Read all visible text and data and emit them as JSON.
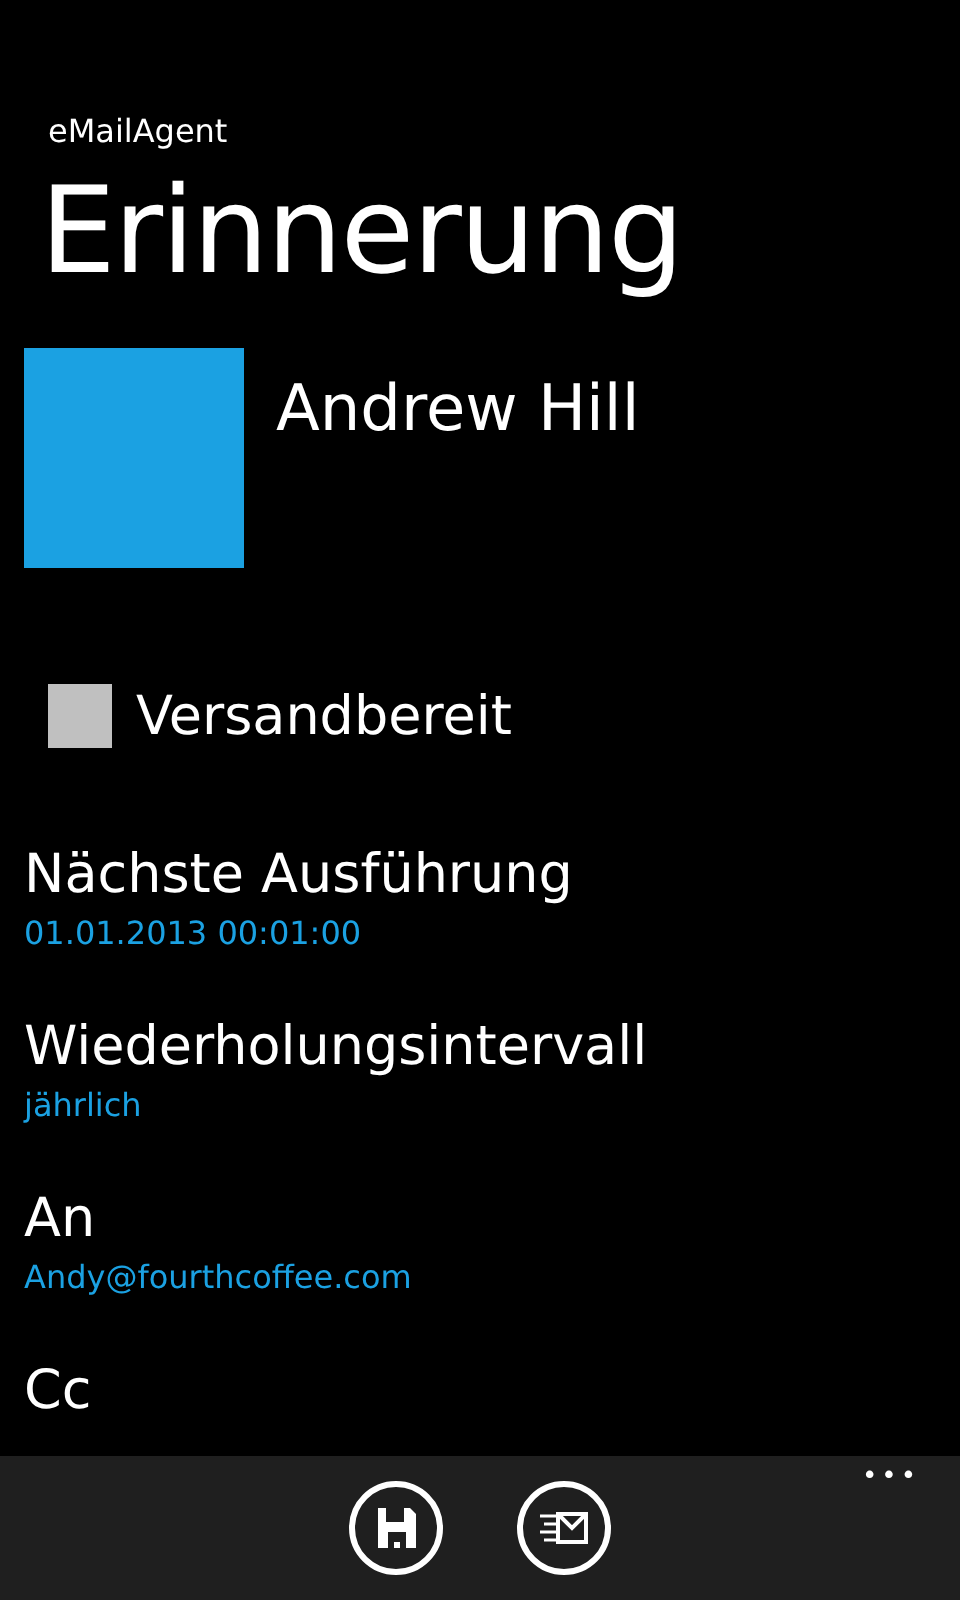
{
  "app_name": "eMailAgent",
  "page_title": "Erinnerung",
  "contact": {
    "name": "Andrew Hill"
  },
  "ready_checkbox": {
    "label": "Versandbereit",
    "checked": false
  },
  "fields": [
    {
      "label": "Nächste Ausführung",
      "value": "01.01.2013 00:01:00"
    },
    {
      "label": "Wiederholungsintervall",
      "value": "jährlich"
    },
    {
      "label": "An",
      "value": "Andy@fourthcoffee.com"
    },
    {
      "label": "Cc"
    }
  ],
  "app_bar": {
    "buttons": [
      {
        "kind": "save"
      },
      {
        "kind": "send"
      }
    ],
    "more": "•••"
  }
}
